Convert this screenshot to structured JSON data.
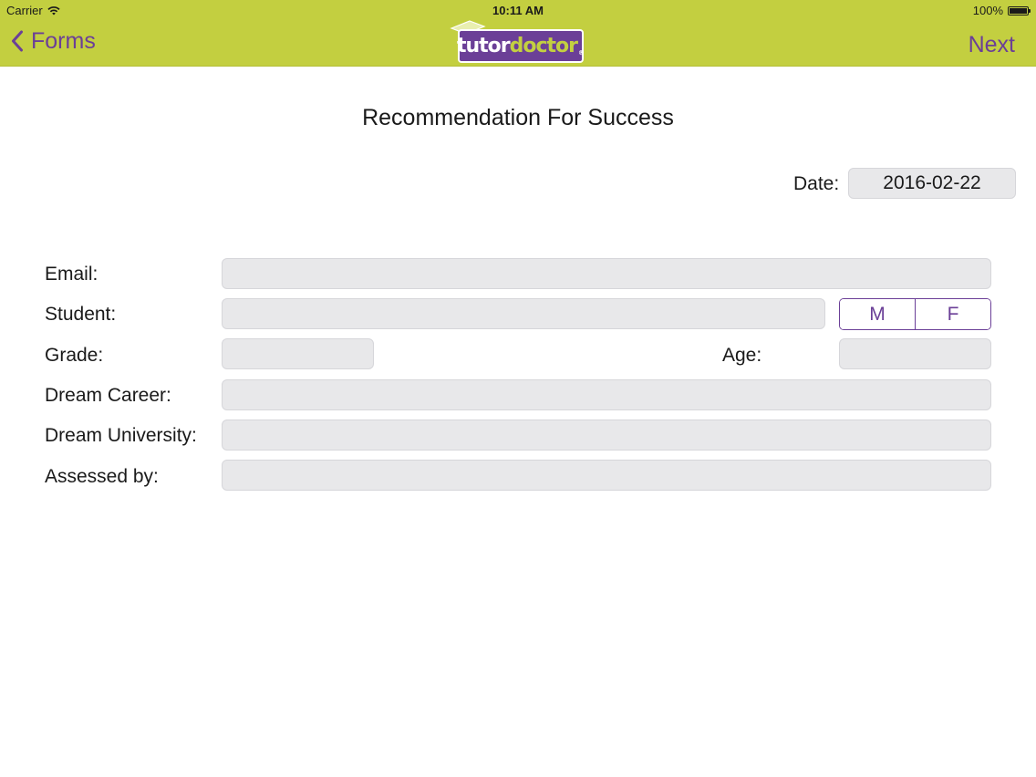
{
  "status_bar": {
    "carrier": "Carrier",
    "time": "10:11 AM",
    "battery_percent": "100%",
    "wifi_icon": "wifi-icon",
    "battery_icon": "battery-icon"
  },
  "nav": {
    "back_label": "Forms",
    "back_icon": "chevron-left-icon",
    "next_label": "Next",
    "accent_color": "#6b3f97",
    "bar_color": "#c3cf40"
  },
  "logo": {
    "tutor": "tutor",
    "doctor": "doctor",
    "mark": "®"
  },
  "form": {
    "title": "Recommendation For Success",
    "date_label": "Date:",
    "date_value": "2016-02-22",
    "email_label": "Email:",
    "email_value": "",
    "student_label": "Student:",
    "student_value": "",
    "gender_options": [
      "M",
      "F"
    ],
    "grade_label": "Grade:",
    "grade_value": "",
    "age_label": "Age:",
    "age_value": "",
    "dream_career_label": "Dream Career:",
    "dream_career_value": "",
    "dream_university_label": "Dream University:",
    "dream_university_value": "",
    "assessed_by_label": "Assessed by:",
    "assessed_by_value": ""
  }
}
